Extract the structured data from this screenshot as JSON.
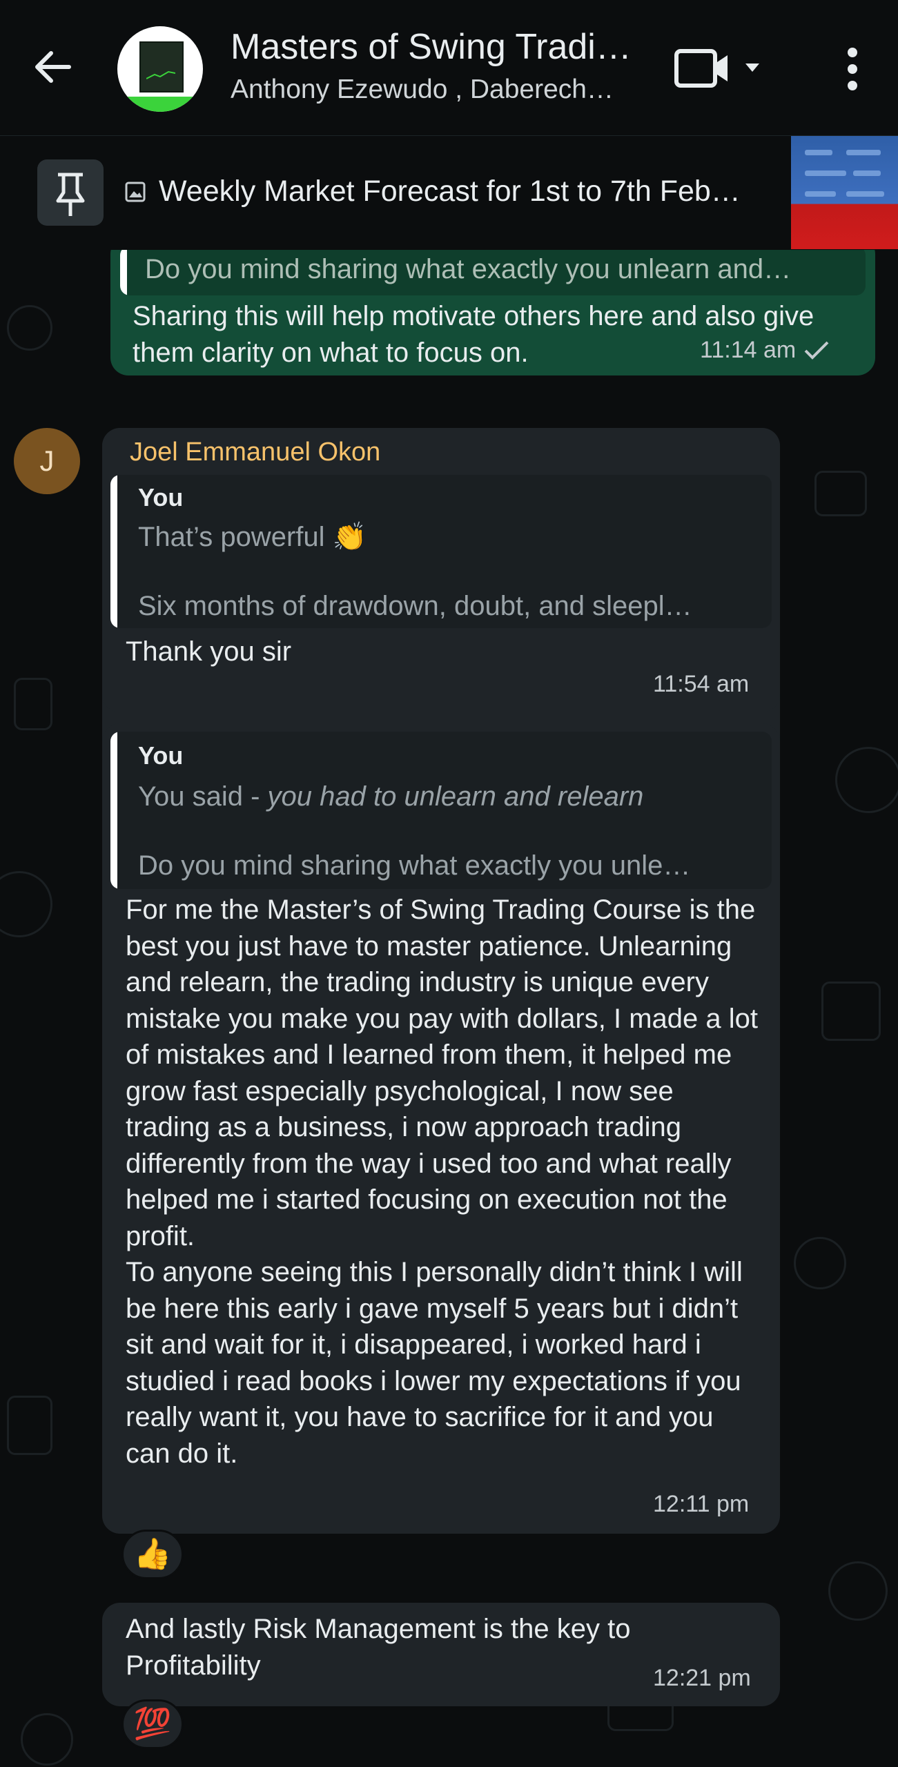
{
  "header": {
    "title": "Masters of Swing Tradi…",
    "subtitle": "Anthony Ezewudo , Daberech…"
  },
  "pinned": {
    "text": "Weekly Market Forecast for 1st to 7th Feb…"
  },
  "messages": {
    "m1": {
      "quote": "Do you mind sharing what exactly you unlearn and…",
      "text": "Sharing this will help motivate others here and also give them clarity on what to focus on.",
      "time": "11:14 am"
    },
    "m2": {
      "sender": "Joel Emmanuel Okon",
      "avatar_letter": "J",
      "quote_author": "You",
      "quote_line1": "That’s powerful 👏",
      "quote_line2": "Six months of drawdown, doubt, and sleepl…",
      "text": "Thank you sir",
      "time": "11:54 am"
    },
    "m3": {
      "quote_author": "You",
      "quote_said_prefix": "You said - ",
      "quote_said_italic": "you had to unlearn and relearn",
      "quote_line2": "Do you mind sharing what exactly you unle…",
      "text": "For me the Master’s of Swing Trading Course is the best you just have to master patience. Unlearning and relearn, the trading industry is unique every mistake you make you pay with dollars, I made a lot of mistakes and I learned from them, it helped me grow fast especially psychological, I now see trading as a business, i now approach trading differently from the way i used too and what really helped me i started focusing on execution not the profit.\nTo anyone seeing this I personally didn’t think I will be here this early i gave myself 5 years but i didn’t sit and wait for it, i disappeared, i worked hard i studied i read books i lower my expectations if you really want it, you have to sacrifice for it and you can do it.",
      "time": "12:11 pm",
      "reaction": "👍"
    },
    "m4": {
      "text": "And lastly Risk Management is the key to Profitability",
      "time": "12:21 pm",
      "reaction": "💯"
    }
  },
  "colors": {
    "outgoing_bubble": "#134d37",
    "incoming_bubble": "#1f2428",
    "sender_name": "#f7c26b",
    "quote_bar": "#ffffff",
    "avatar_bg": "#7a5320"
  }
}
